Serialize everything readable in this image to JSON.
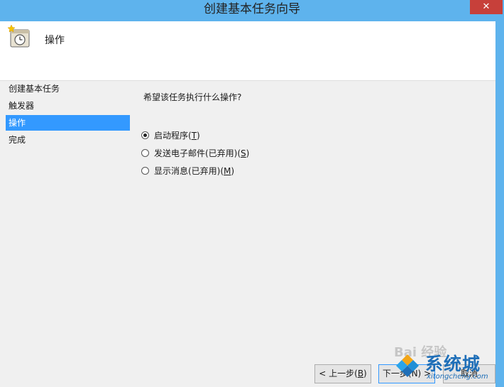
{
  "window": {
    "title": "创建基本任务向导",
    "close_glyph": "✕"
  },
  "header": {
    "title": "操作",
    "icon": "task-clock-icon"
  },
  "sidebar": {
    "items": [
      {
        "label": "创建基本任务"
      },
      {
        "label": "触发器"
      },
      {
        "label": "操作"
      },
      {
        "label": "完成"
      }
    ]
  },
  "main": {
    "question": "希望该任务执行什么操作?",
    "options": [
      {
        "label": "启动程序(",
        "key": "T",
        "suffix": ")"
      },
      {
        "label": "发送电子邮件(已弃用)(",
        "key": "S",
        "suffix": ")"
      },
      {
        "label": "显示消息(已弃用)(",
        "key": "M",
        "suffix": ")"
      }
    ],
    "selected_option": 0
  },
  "footer": {
    "back": {
      "label": "< 上一步(",
      "key": "B",
      "suffix": ")"
    },
    "next": {
      "label": "下一步(N) >"
    },
    "cancel": {
      "label": "取消"
    }
  },
  "watermark": {
    "faint": "Bai 经验",
    "cn": "系统城",
    "en": "xitongcheng.com"
  },
  "colors": {
    "titlebar": "#5eb3ed",
    "selection": "#3399ff",
    "close": "#c7403a"
  }
}
